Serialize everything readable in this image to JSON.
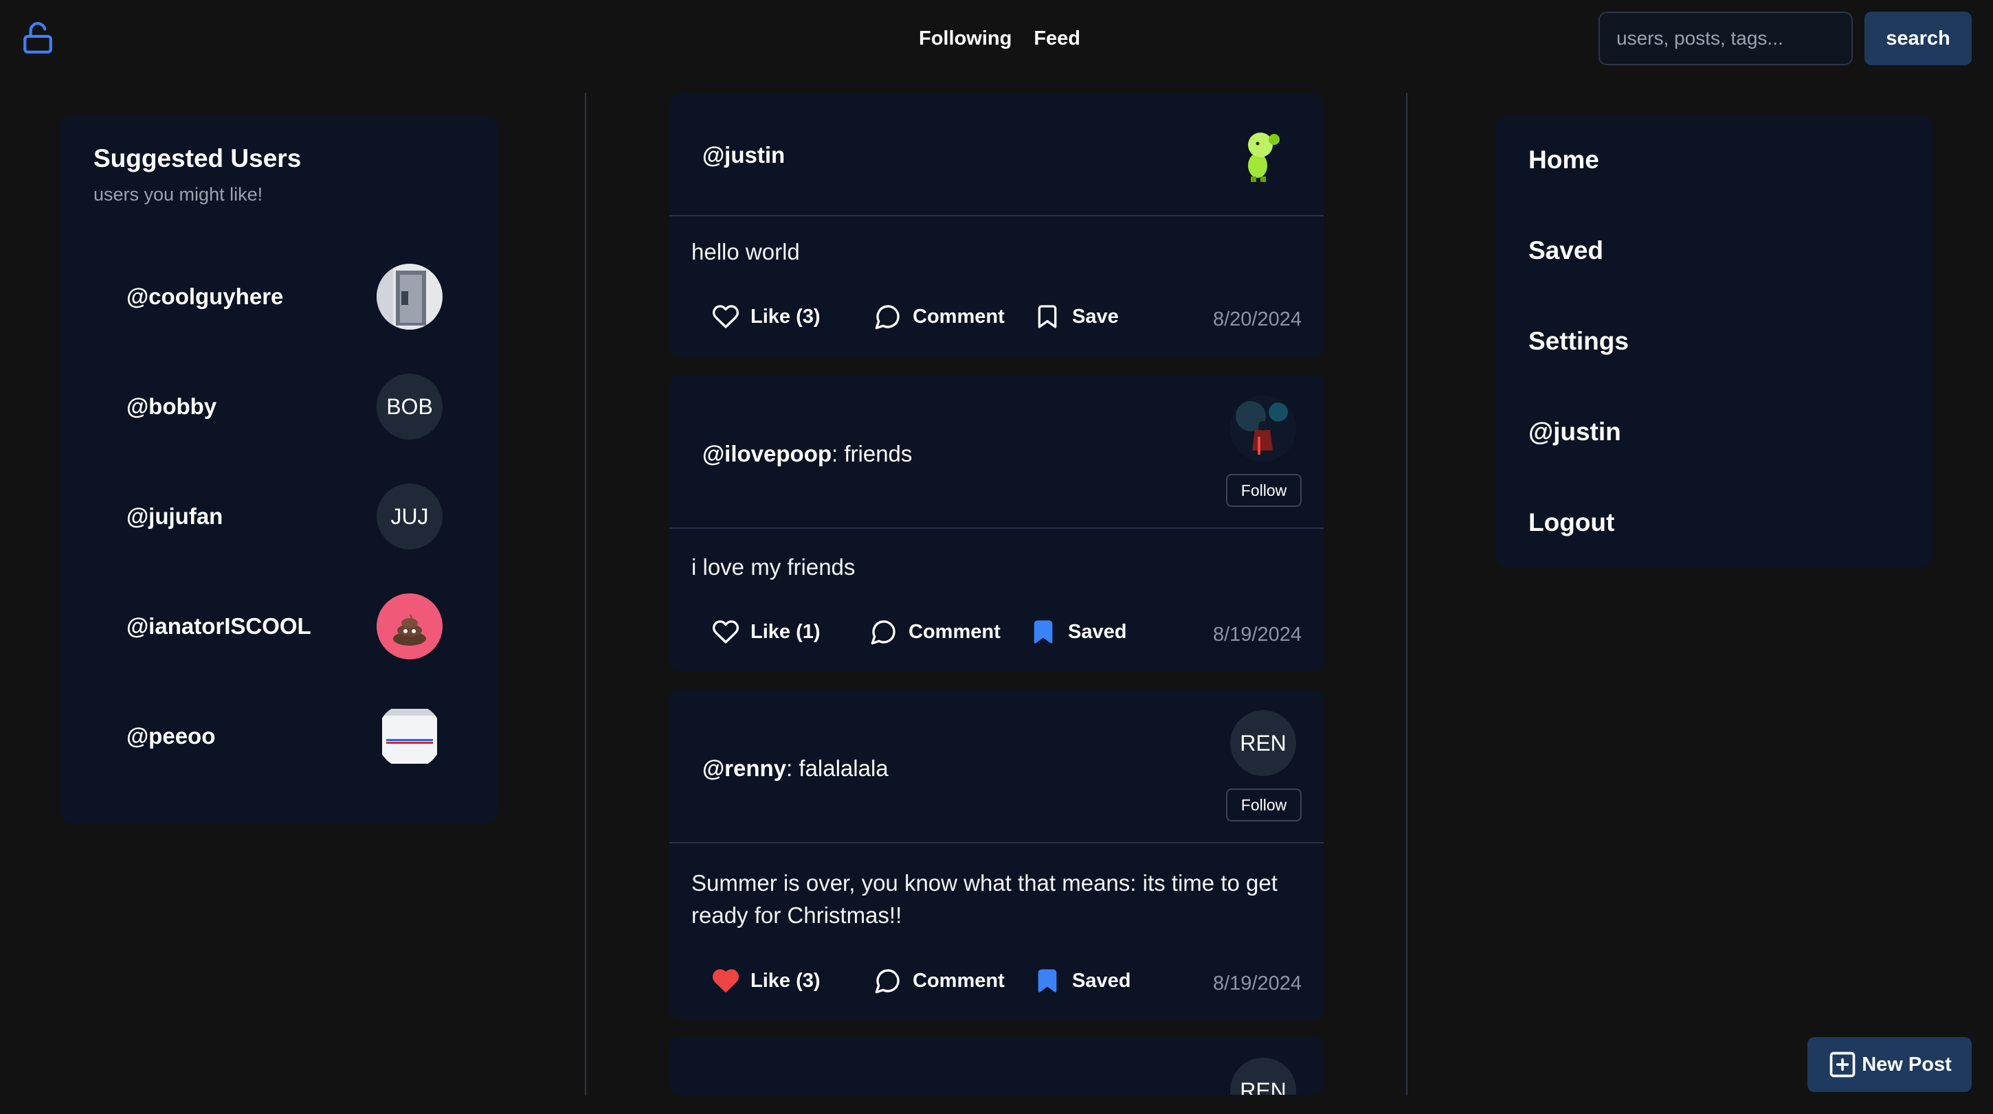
{
  "header": {
    "nav": [
      {
        "label": "Following"
      },
      {
        "label": "Feed"
      }
    ],
    "search": {
      "placeholder": "users, posts, tags...",
      "button_label": "search"
    },
    "icon": "lock-open-icon"
  },
  "suggested": {
    "title": "Suggested Users",
    "subtitle": "users you might like!",
    "users": [
      {
        "handle": "@coolguyhere",
        "avatar": "photo"
      },
      {
        "handle": "@bobby",
        "avatar_text": "BOB"
      },
      {
        "handle": "@jujufan",
        "avatar_text": "JUJ"
      },
      {
        "handle": "@ianatorISCOOL",
        "avatar": "photo"
      },
      {
        "handle": "@peeoo",
        "avatar": "photo"
      }
    ]
  },
  "posts": [
    {
      "author": "@justin",
      "tag": "",
      "text": "hello world",
      "like_label": "Like (3)",
      "liked": false,
      "comment_label": "Comment",
      "save_label": "Save",
      "saved": false,
      "date": "8/20/2024"
    },
    {
      "author": "@ilovepoop",
      "tag": ": friends",
      "follow_label": "Follow",
      "text": "i love my friends",
      "like_label": "Like (1)",
      "liked": false,
      "comment_label": "Comment",
      "save_label": "Saved",
      "saved": true,
      "date": "8/19/2024"
    },
    {
      "author": "@renny",
      "tag": ": falalalala",
      "avatar_text": "REN",
      "follow_label": "Follow",
      "text": "Summer is over, you know what that means: its time to get ready for Christmas!!",
      "like_label": "Like (3)",
      "liked": true,
      "comment_label": "Comment",
      "save_label": "Saved",
      "saved": true,
      "date": "8/19/2024"
    },
    {
      "avatar_text": "REN"
    }
  ],
  "sidebar": {
    "items": [
      {
        "label": "Home"
      },
      {
        "label": "Saved"
      },
      {
        "label": "Settings"
      },
      {
        "label": "@justin"
      },
      {
        "label": "Logout"
      }
    ]
  },
  "new_post": {
    "label": "New Post"
  },
  "colors": {
    "background": "#121212",
    "panel": "#0b1324",
    "accent": "#1e3a5f",
    "bookmark_blue": "#3b82f6",
    "like_red": "#ef4444"
  }
}
